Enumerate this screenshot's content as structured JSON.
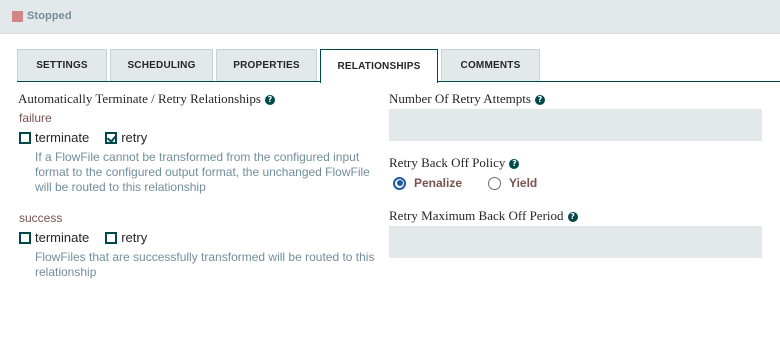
{
  "header": {
    "status": "Stopped"
  },
  "tabs": [
    "SETTINGS",
    "SCHEDULING",
    "PROPERTIES",
    "RELATIONSHIPS",
    "COMMENTS"
  ],
  "relationships": {
    "heading": "Automatically Terminate / Retry Relationships",
    "items": [
      {
        "name": "failure",
        "terminate_label": "terminate",
        "retry_label": "retry",
        "terminate_checked": false,
        "retry_checked": true,
        "description": "If a FlowFile cannot be transformed from the configured input format to the configured output format, the unchanged FlowFile will be routed to this relationship"
      },
      {
        "name": "success",
        "terminate_label": "terminate",
        "retry_label": "retry",
        "terminate_checked": false,
        "retry_checked": false,
        "description": "FlowFiles that are successfully transformed will be routed to this relationship"
      }
    ]
  },
  "retry": {
    "attempts_label": "Number Of Retry Attempts",
    "attempts_value": "",
    "policy_label": "Retry Back Off Policy",
    "policy_options": [
      "Penalize",
      "Yield"
    ],
    "policy_selected": "Penalize",
    "max_period_label": "Retry Maximum Back Off Period",
    "max_period_value": ""
  },
  "colors": {
    "accent": "#004849",
    "relationship_name": "#775351",
    "status_stopped": "#d18686",
    "input_bg": "#e3e8eb"
  }
}
